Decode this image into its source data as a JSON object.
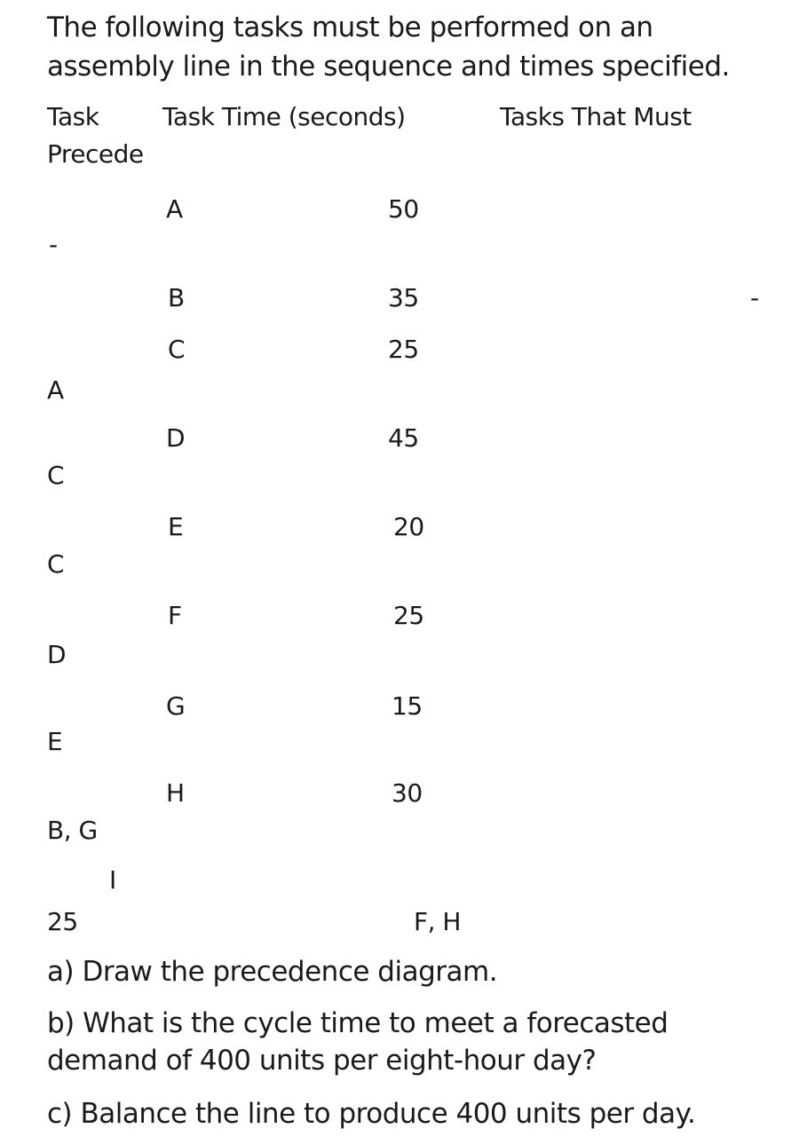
{
  "intro": {
    "line1": "The following tasks must be performed on an",
    "line2": "assembly line in the sequence and times specified."
  },
  "table_header": {
    "task": "Task",
    "task_time": "Task Time (seconds)",
    "tasks_must": "Tasks That Must",
    "precede": "Precede"
  },
  "fragments": {
    "dash_left": "-",
    "dash_right": "-",
    "task_A_label": "A",
    "time_A": "50",
    "task_B_label": "B",
    "time_B": "35",
    "task_C_label": "C",
    "time_C": "25",
    "pred_C": "A",
    "task_D_label": "D",
    "time_D": "45",
    "pred_D": "C",
    "task_E_label": "E",
    "time_E": "20",
    "pred_E": "C",
    "task_F_label": "F",
    "time_F": "25",
    "pred_F": "D",
    "task_G_label": "G",
    "time_G": "15",
    "pred_G": "E",
    "task_H_label": "H",
    "time_H": "30",
    "pred_H": "B, G",
    "task_I_label": "I",
    "time_I": "25",
    "pred_I": "F, H"
  },
  "questions": {
    "a": "a) Draw the precedence diagram.",
    "b_line1": "b) What is the cycle time to meet a forecasted",
    "b_line2": "demand of 400 units per eight-hour day?",
    "c": "c) Balance the line to produce 400 units per day."
  }
}
